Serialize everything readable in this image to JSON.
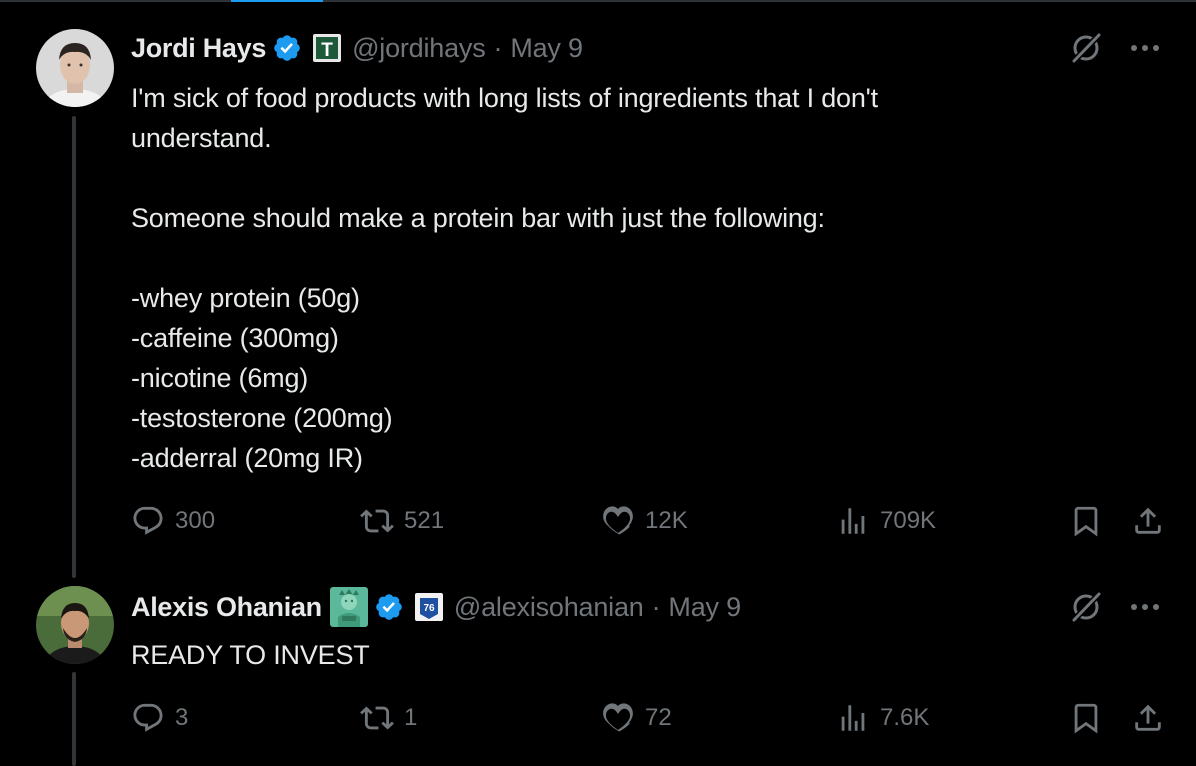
{
  "tweets": [
    {
      "name": "Jordi Hays",
      "handle": "@jordihays",
      "sep": "·",
      "date": "May 9",
      "affiliation_glyph": "T",
      "text": "I'm sick of food products with long lists of ingredients that I don't\nunderstand.\n\nSomeone should make a protein bar with just the following:\n\n-whey protein (50g)\n-caffeine (300mg)\n-nicotine (6mg)\n-testosterone (200mg)\n-adderral (20mg IR)",
      "replies": "300",
      "reposts": "521",
      "likes": "12K",
      "views": "709K"
    },
    {
      "name": "Alexis Ohanian",
      "handle": "@alexisohanian",
      "sep": "·",
      "date": "May 9",
      "affiliation_glyph": "76",
      "text": "READY TO INVEST",
      "replies": "3",
      "reposts": "1",
      "likes": "72",
      "views": "7.6K"
    }
  ],
  "colors": {
    "background": "#000000",
    "text": "#e7e9ea",
    "muted": "#71767b",
    "verified": "#1d9bf0",
    "thread_line": "#333639"
  },
  "icons": [
    "verified-badge-icon",
    "grok-icon",
    "more-icon",
    "reply-icon",
    "repost-icon",
    "like-icon",
    "views-icon",
    "bookmark-icon",
    "share-icon",
    "statue-of-liberty-emoji"
  ]
}
